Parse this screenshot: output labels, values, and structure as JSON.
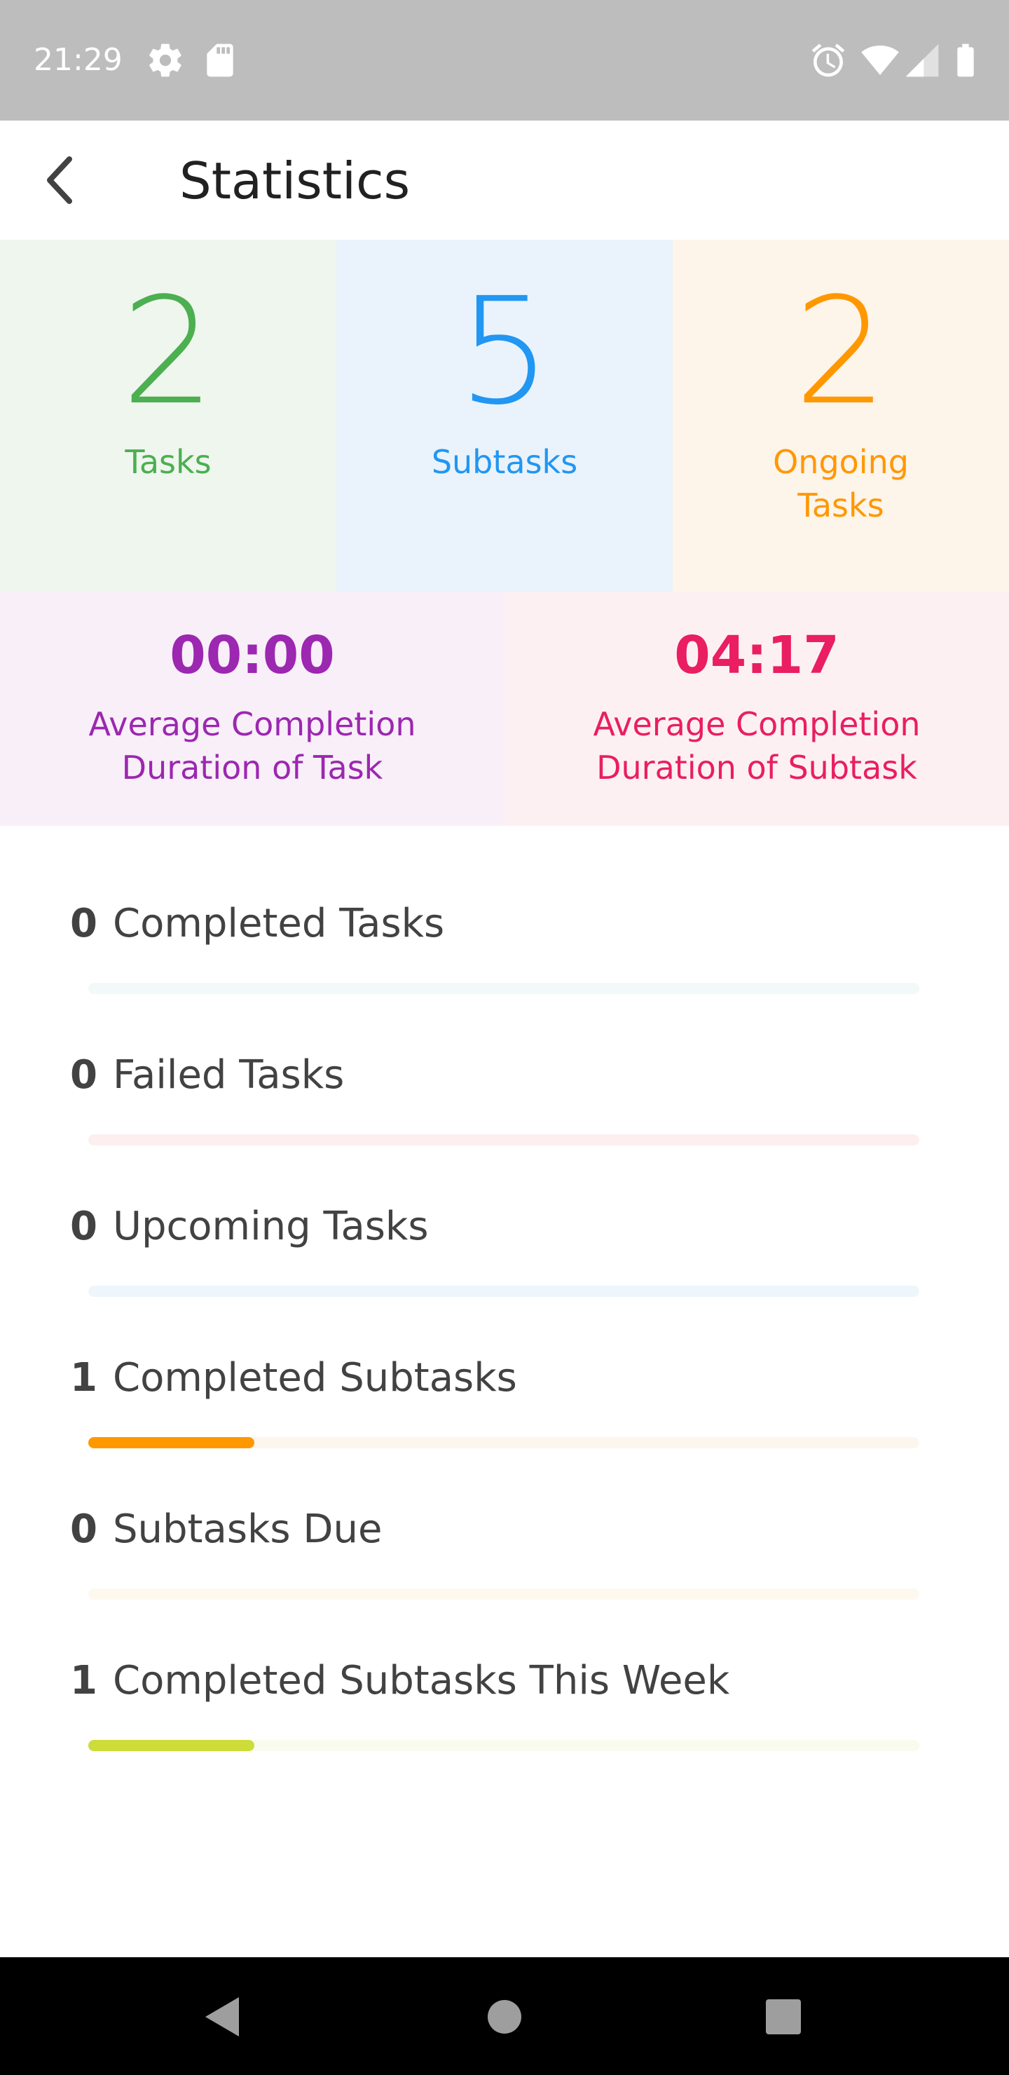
{
  "status_bar": {
    "time": "21:29",
    "icons": [
      "gear-icon",
      "sd-card-icon",
      "alarm-icon",
      "wifi-icon",
      "signal-icon",
      "battery-icon"
    ]
  },
  "app_bar": {
    "title": "Statistics",
    "back_icon": "back-arrow-icon"
  },
  "stats": {
    "tasks": {
      "value": "2",
      "label": "Tasks",
      "color": "#4caf50"
    },
    "subtasks": {
      "value": "5",
      "label": "Subtasks",
      "color": "#2196f3"
    },
    "ongoing": {
      "value": "2",
      "label": "Ongoing Tasks",
      "color": "#ff9800"
    }
  },
  "durations": {
    "task": {
      "value": "00:00",
      "label": "Average Completion Duration of Task",
      "color": "#9c27b0"
    },
    "subtask": {
      "value": "04:17",
      "label": "Average Completion Duration of Subtask",
      "color": "#e91e63"
    }
  },
  "progress": [
    {
      "count": "0",
      "label": "Completed Tasks",
      "fraction": 0,
      "color": "#4caf50",
      "track": "#f2f9f8"
    },
    {
      "count": "0",
      "label": "Failed Tasks",
      "fraction": 0,
      "color": "#f44336",
      "track": "#fdeff0"
    },
    {
      "count": "0",
      "label": "Upcoming Tasks",
      "fraction": 0,
      "color": "#2196f3",
      "track": "#eef6fc"
    },
    {
      "count": "1",
      "label": "Completed Subtasks",
      "fraction": 0.2,
      "color": "#ff9800",
      "track": "#fdf6ee"
    },
    {
      "count": "0",
      "label": "Subtasks Due",
      "fraction": 0,
      "color": "#ffc107",
      "track": "#fdf9ee"
    },
    {
      "count": "1",
      "label": "Completed Subtasks This Week",
      "fraction": 0.2,
      "color": "#cddc39",
      "track": "#f8fbee"
    }
  ],
  "nav_bar": {
    "buttons": [
      "back-triangle-icon",
      "home-circle-icon",
      "recents-square-icon"
    ]
  }
}
